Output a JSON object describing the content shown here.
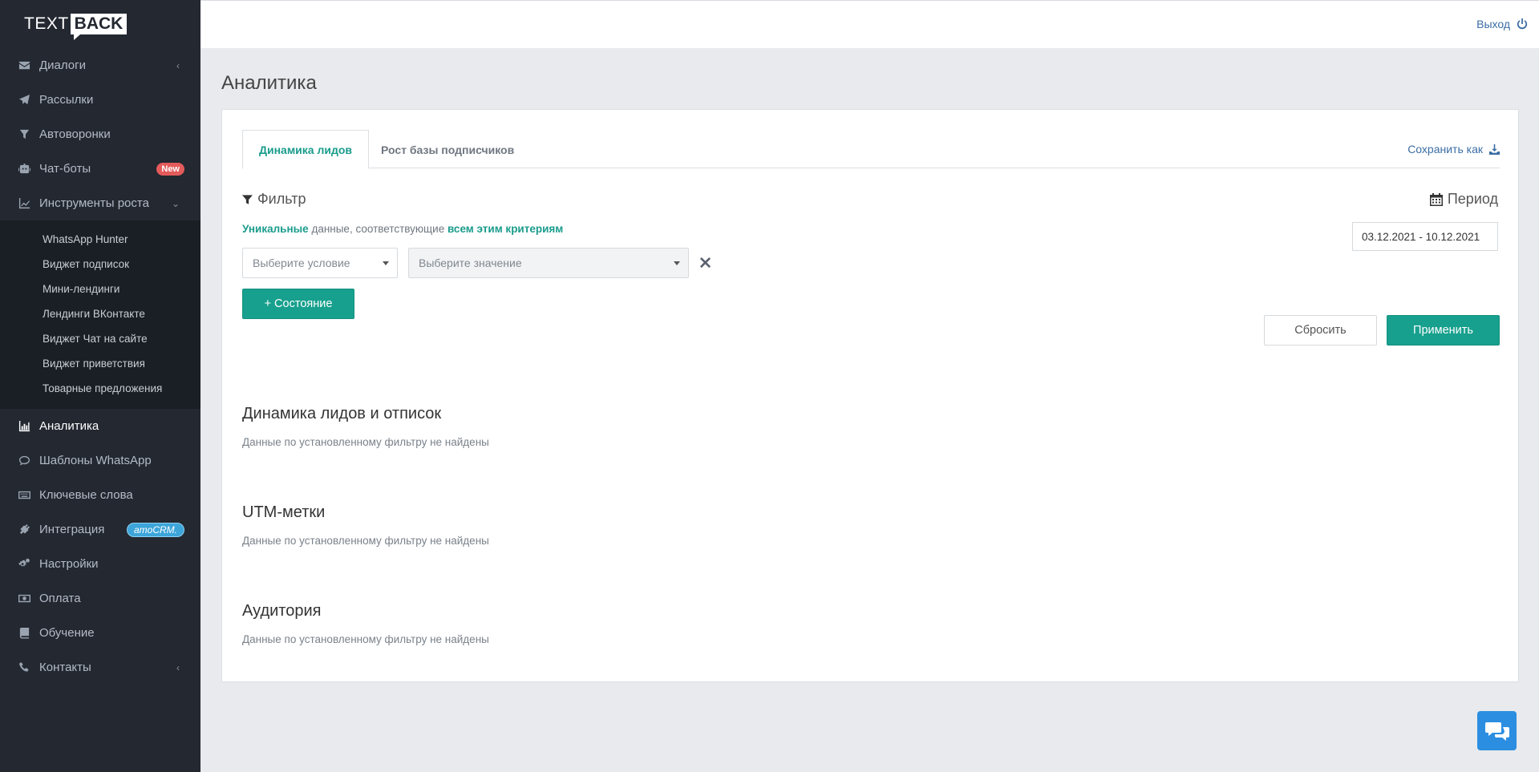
{
  "logo": {
    "text_part": "TEXT",
    "back_part": "BACK"
  },
  "sidebar": {
    "items": [
      {
        "label": "Диалоги",
        "icon": "envelope-icon"
      },
      {
        "label": "Рассылки",
        "icon": "paper-plane-icon"
      },
      {
        "label": "Автоворонки",
        "icon": "funnel-icon"
      },
      {
        "label": "Чат-боты",
        "icon": "robot-icon",
        "badge": "New"
      },
      {
        "label": "Инструменты роста",
        "icon": "line-chart-icon"
      },
      {
        "label": "Аналитика",
        "icon": "bar-chart-icon"
      },
      {
        "label": "Шаблоны WhatsApp",
        "icon": "comment-icon"
      },
      {
        "label": "Ключевые слова",
        "icon": "keyboard-icon"
      },
      {
        "label": "Интеграция",
        "icon": "plug-icon",
        "badge": "amoCRM."
      },
      {
        "label": "Настройки",
        "icon": "gears-icon"
      },
      {
        "label": "Оплата",
        "icon": "money-icon"
      },
      {
        "label": "Обучение",
        "icon": "book-icon"
      },
      {
        "label": "Контакты",
        "icon": "phone-icon"
      }
    ],
    "subitems": [
      "WhatsApp Hunter",
      "Виджет подписок",
      "Мини-лендинги",
      "Лендинги ВКонтакте",
      "Виджет Чат на сайте",
      "Виджет приветствия",
      "Товарные предложения"
    ]
  },
  "topbar": {
    "logout_label": "Выход"
  },
  "page": {
    "title": "Аналитика"
  },
  "tabs": [
    {
      "label": "Динамика лидов",
      "active": true
    },
    {
      "label": "Рост базы подписчиков",
      "active": false
    }
  ],
  "save_as_label": "Сохранить как",
  "filter": {
    "title": "Фильтр",
    "criteria_unique": "Уникальные",
    "criteria_middle": "данные, соответствующие",
    "criteria_all": "всем этим критериям",
    "condition_placeholder": "Выберите условие",
    "value_placeholder": "Выберите значение",
    "add_state_label": "+ Состояние"
  },
  "period": {
    "title": "Период",
    "range": "03.12.2021 - 10.12.2021"
  },
  "actions": {
    "reset_label": "Сбросить",
    "apply_label": "Применить"
  },
  "sections": [
    {
      "title": "Динамика лидов и отписок",
      "note": "Данные по установленному фильтру не найдены"
    },
    {
      "title": "UTM-метки",
      "note": "Данные по установленному фильтру не найдены"
    },
    {
      "title": "Аудитория",
      "note": "Данные по установленному фильтру не найдены"
    }
  ],
  "colors": {
    "sidebar_bg": "#232831",
    "accent_green": "#17a08d",
    "link_blue": "#3b6ea5",
    "badge_red": "#e35b5b",
    "chat_blue": "#2b8ee0"
  }
}
